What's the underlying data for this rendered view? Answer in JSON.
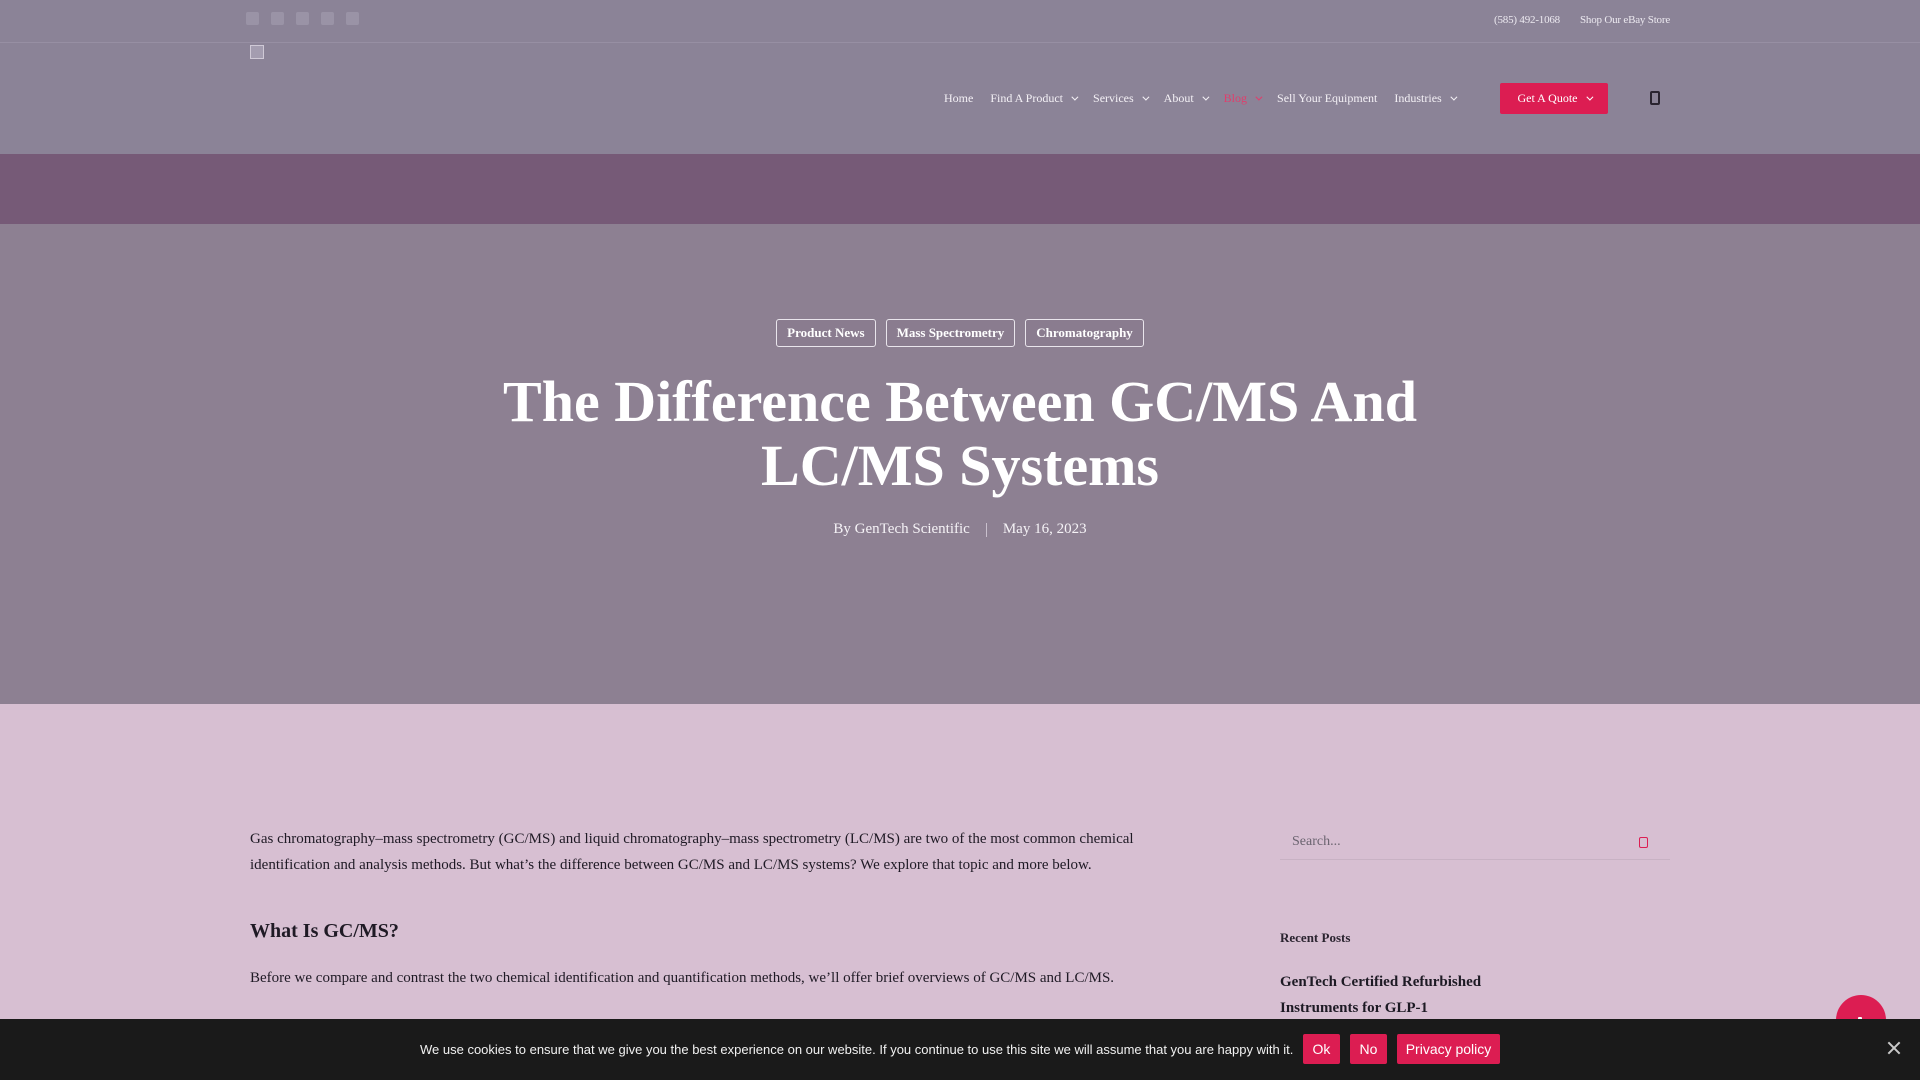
{
  "topbar": {
    "social_icons": [
      "facebook-icon",
      "twitter-icon",
      "linkedin-icon",
      "youtube-icon",
      "instagram-icon"
    ],
    "phone": "(585) 492-1068",
    "ebay_link": "Shop Our eBay Store"
  },
  "header": {
    "nav": [
      {
        "label": "Home",
        "has_dropdown": false
      },
      {
        "label": "Find A Product",
        "has_dropdown": true
      },
      {
        "label": "Services",
        "has_dropdown": true
      },
      {
        "label": "About",
        "has_dropdown": true
      },
      {
        "label": "Blog",
        "has_dropdown": true,
        "active": true
      },
      {
        "label": "Sell Your Equipment",
        "has_dropdown": false
      },
      {
        "label": "Industries",
        "has_dropdown": true
      }
    ],
    "cta_label": "Get A Quote",
    "active_color": "#e03e6c",
    "accent_color": "#dc1d52"
  },
  "hero": {
    "tags": [
      "Product News",
      "Mass Spectrometry",
      "Chromatography"
    ],
    "title": "The Difference Between GC/MS And LC/MS Systems",
    "author": "By GenTech Scientific",
    "date": "May 16, 2023"
  },
  "article": {
    "intro": "Gas chromatography–mass spectrometry (GC/MS) and liquid chromatography–mass spectrometry (LC/MS) are two of the most common chemical identification and analysis methods. But what’s the difference between GC/MS and LC/MS systems? We explore that topic and more below.",
    "heading": "What Is GC/MS?",
    "para2": "Before we compare and contrast the two chemical identification and quantification methods, we’ll offer brief overviews of GC/MS and LC/MS."
  },
  "sidebar": {
    "search_placeholder": "Search...",
    "recent_heading": "Recent Posts",
    "recent_post": "GenTech Certified Refurbished Instruments for GLP-1"
  },
  "cookie": {
    "message": "We use cookies to ensure that we give you the best experience on our website. If you continue to use this site we will assume that you are happy with it.",
    "ok": "Ok",
    "no": "No",
    "privacy": "Privacy policy"
  }
}
